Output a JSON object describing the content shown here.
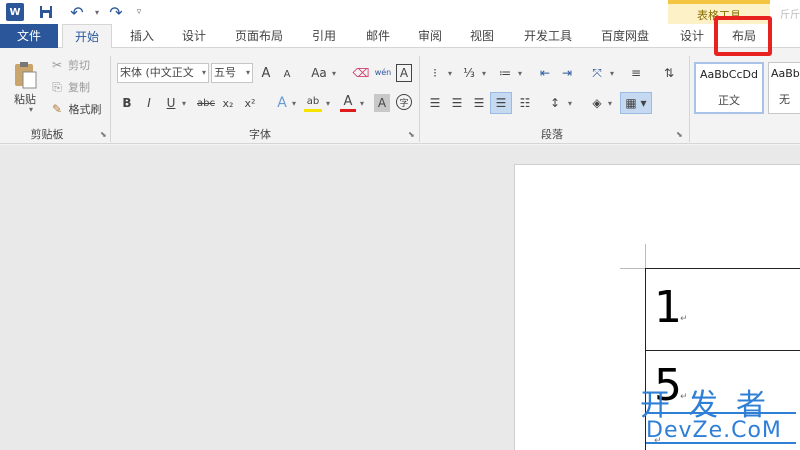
{
  "app": {
    "logo_letter": "W"
  },
  "quick_access": {
    "undo_arrow": "▾",
    "more": "▿"
  },
  "context_tab_group": {
    "label": "表格工具",
    "extra": "斤斤"
  },
  "tabs": [
    {
      "label": "文件"
    },
    {
      "label": "开始"
    },
    {
      "label": "插入"
    },
    {
      "label": "设计"
    },
    {
      "label": "页面布局"
    },
    {
      "label": "引用"
    },
    {
      "label": "邮件"
    },
    {
      "label": "审阅"
    },
    {
      "label": "视图"
    },
    {
      "label": "开发工具"
    },
    {
      "label": "百度网盘"
    },
    {
      "label": "设计"
    },
    {
      "label": "布局"
    }
  ],
  "clipboard": {
    "paste": "粘贴",
    "cut": "剪切",
    "copy": "复制",
    "format_painter": "格式刷",
    "group_label": "剪贴板"
  },
  "font": {
    "font_name": "宋体 (中文正文",
    "font_size": "五号",
    "bold": "B",
    "italic": "I",
    "underline": "U",
    "strike": "abc",
    "subscript": "x₂",
    "superscript": "x²",
    "grow": "A",
    "shrink": "A",
    "change_case": "Aa",
    "phonetic": "wén",
    "char_border": "A",
    "text_effects": "A",
    "highlight": "ab",
    "font_color": "A",
    "char_shading": "A",
    "enclose": "字",
    "group_label": "字体"
  },
  "paragraph": {
    "group_label": "段落"
  },
  "styles": [
    {
      "preview": "AaBbCcDd",
      "name": "正文"
    },
    {
      "preview": "AaBb",
      "name": "无"
    }
  ],
  "document": {
    "cell1": "1",
    "cell2": "5",
    "para_mark": "↵"
  },
  "watermark": {
    "line1": "开发者",
    "line2": "DevZe.CoM"
  },
  "colors": {
    "accent": "#2b579a",
    "highlight_box": "#e8231f",
    "watermark": "#2f7fd6",
    "context_band": "#fdf1c7"
  }
}
